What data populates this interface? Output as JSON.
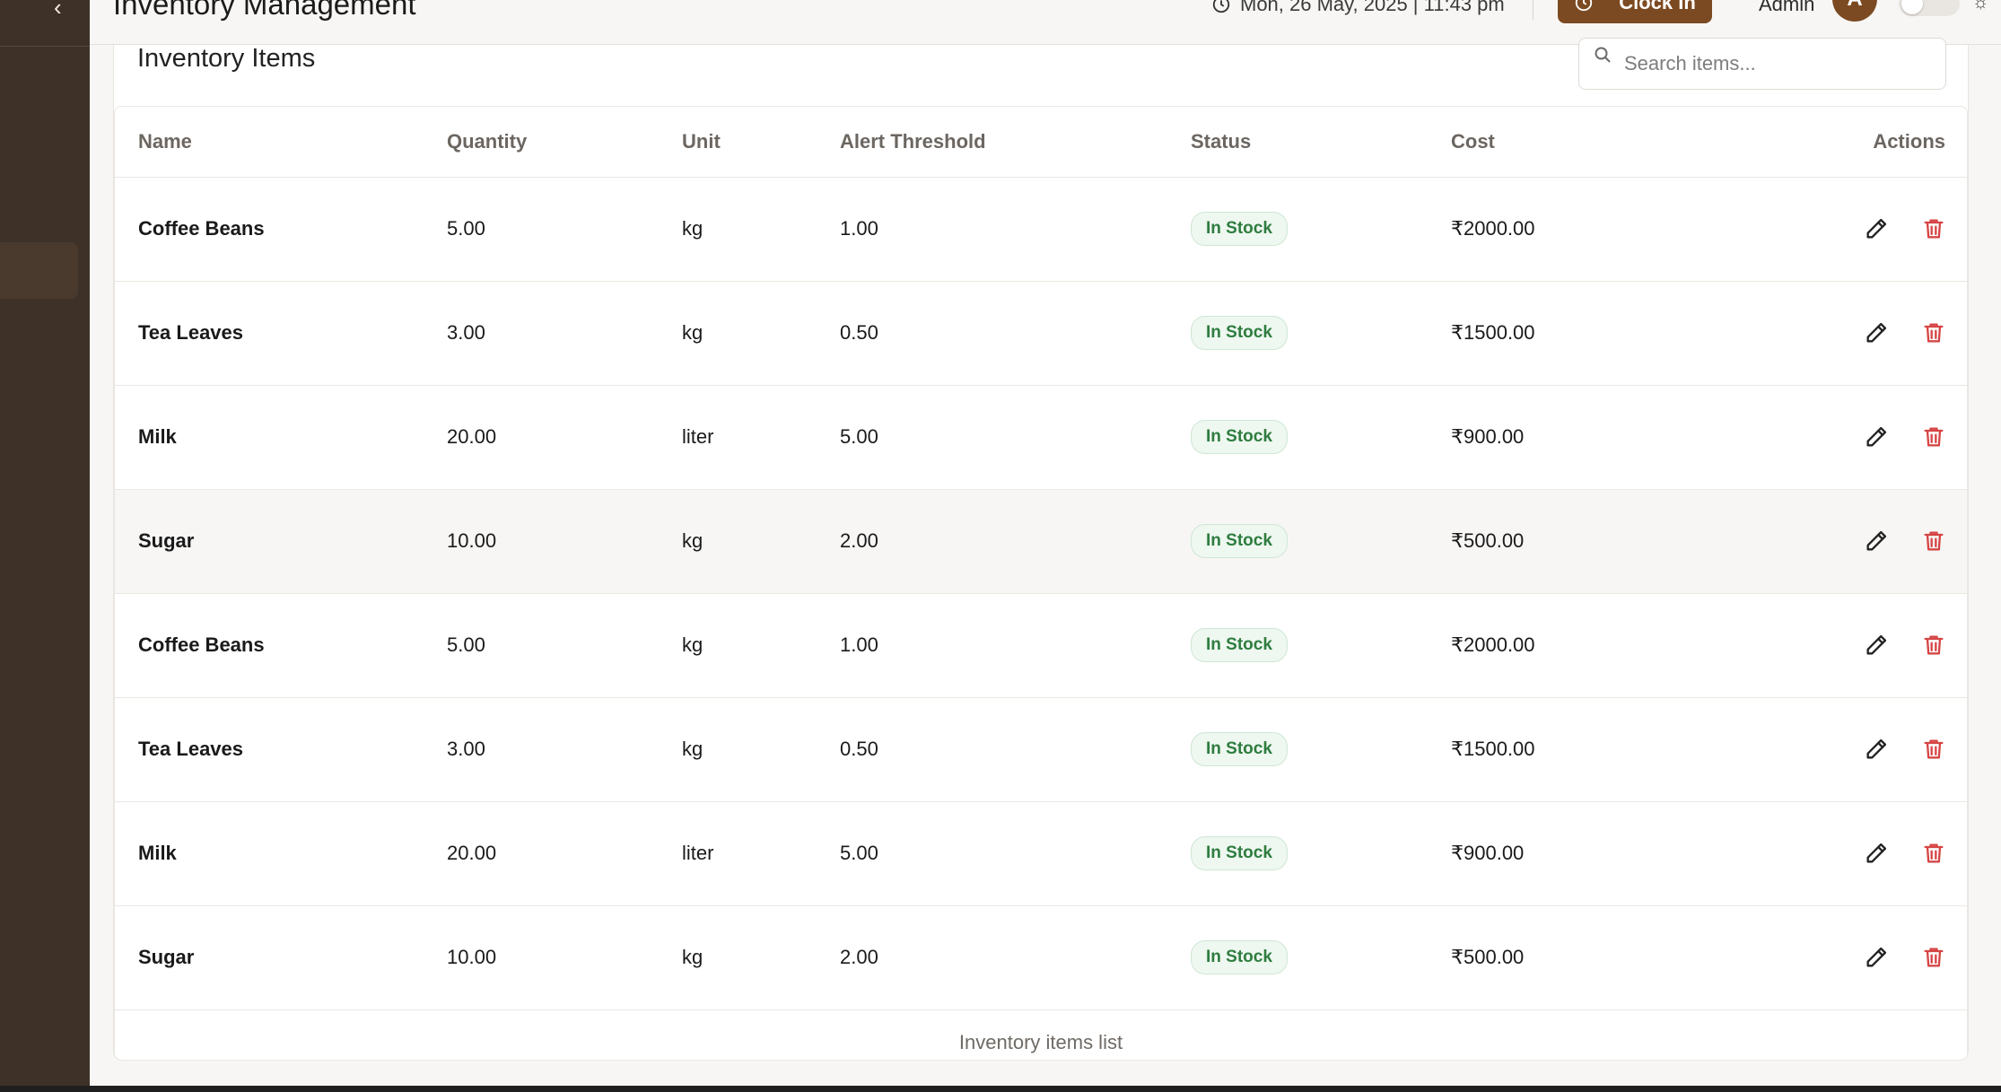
{
  "window": {
    "title": "Inventory Management"
  },
  "header": {
    "datetime": "Mon, 26 May, 2025 | 11:43 pm",
    "clock_in_label": "Clock In",
    "user_label": "Admin",
    "avatar_initial": "A"
  },
  "card": {
    "title": "Inventory Items",
    "search_placeholder": "Search items...",
    "caption": "Inventory items list"
  },
  "table": {
    "headers": [
      "Name",
      "Quantity",
      "Unit",
      "Alert Threshold",
      "Status",
      "Cost",
      "Actions"
    ],
    "rows": [
      {
        "name": "Coffee Beans",
        "quantity": "5.00",
        "unit": "kg",
        "alert": "1.00",
        "status": "In Stock",
        "cost": "₹2000.00"
      },
      {
        "name": "Tea Leaves",
        "quantity": "3.00",
        "unit": "kg",
        "alert": "0.50",
        "status": "In Stock",
        "cost": "₹1500.00"
      },
      {
        "name": "Milk",
        "quantity": "20.00",
        "unit": "liter",
        "alert": "5.00",
        "status": "In Stock",
        "cost": "₹900.00"
      },
      {
        "name": "Sugar",
        "quantity": "10.00",
        "unit": "kg",
        "alert": "2.00",
        "status": "In Stock",
        "cost": "₹500.00"
      },
      {
        "name": "Coffee Beans",
        "quantity": "5.00",
        "unit": "kg",
        "alert": "1.00",
        "status": "In Stock",
        "cost": "₹2000.00"
      },
      {
        "name": "Tea Leaves",
        "quantity": "3.00",
        "unit": "kg",
        "alert": "0.50",
        "status": "In Stock",
        "cost": "₹1500.00"
      },
      {
        "name": "Milk",
        "quantity": "20.00",
        "unit": "liter",
        "alert": "5.00",
        "status": "In Stock",
        "cost": "₹900.00"
      },
      {
        "name": "Sugar",
        "quantity": "10.00",
        "unit": "kg",
        "alert": "2.00",
        "status": "In Stock",
        "cost": "₹500.00"
      }
    ]
  },
  "icons": {
    "back": "chevron-left-icon",
    "clock": "clock-icon",
    "search": "search-icon",
    "edit": "pencil-icon",
    "delete": "trash-icon",
    "theme": "sun-icon"
  },
  "colors": {
    "sidebar": "#3d3128",
    "accent": "#7c4a22",
    "status_green": "#2e7d3f",
    "delete_red": "#d64545"
  }
}
